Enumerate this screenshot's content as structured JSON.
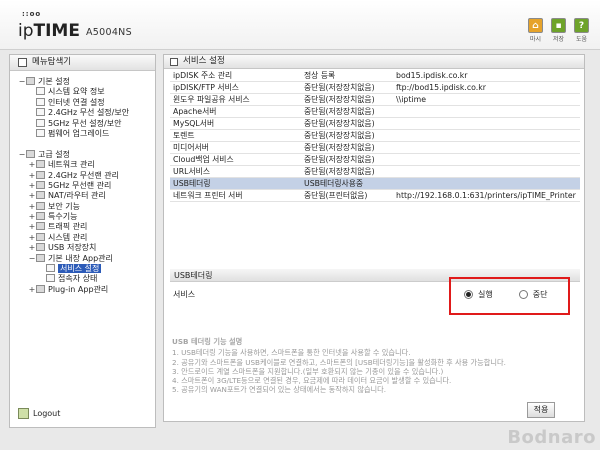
{
  "header": {
    "logo_dots": "::oo",
    "brand_prefix": "ip",
    "brand_main": "TIME",
    "model": "A5004NS",
    "icons": [
      {
        "name": "home-icon",
        "label": "마시",
        "color": "#e6a32a"
      },
      {
        "name": "save-icon",
        "label": "저장",
        "color": "#6ea32a"
      },
      {
        "name": "help-icon",
        "label": "도움",
        "color": "#6ea32a"
      }
    ]
  },
  "sidebar": {
    "title": "메뉴탐색기",
    "logout": "Logout",
    "items": [
      {
        "label": "기본 설정",
        "level": 0,
        "expander": "−",
        "type": "folder"
      },
      {
        "label": "시스템 요약 정보",
        "level": 1,
        "expander": "",
        "type": "page"
      },
      {
        "label": "인터넷 연결 설정",
        "level": 1,
        "expander": "",
        "type": "page"
      },
      {
        "label": "2.4GHz 무선 설정/보안",
        "level": 1,
        "expander": "",
        "type": "page"
      },
      {
        "label": "5GHz 무선 설정/보안",
        "level": 1,
        "expander": "",
        "type": "page"
      },
      {
        "label": "펌웨어 업그레이드",
        "level": 1,
        "expander": "",
        "type": "page"
      },
      {
        "label": "",
        "level": 0,
        "expander": "",
        "type": "spacer"
      },
      {
        "label": "고급 설정",
        "level": 0,
        "expander": "−",
        "type": "folder"
      },
      {
        "label": "네트워크 관리",
        "level": 1,
        "expander": "+",
        "type": "folder"
      },
      {
        "label": "2.4GHz 무선랜 관리",
        "level": 1,
        "expander": "+",
        "type": "folder"
      },
      {
        "label": "5GHz 무선랜 관리",
        "level": 1,
        "expander": "+",
        "type": "folder"
      },
      {
        "label": "NAT/라우터 관리",
        "level": 1,
        "expander": "+",
        "type": "folder"
      },
      {
        "label": "보안 기능",
        "level": 1,
        "expander": "+",
        "type": "folder"
      },
      {
        "label": "특수기능",
        "level": 1,
        "expander": "+",
        "type": "folder"
      },
      {
        "label": "트래픽 관리",
        "level": 1,
        "expander": "+",
        "type": "folder"
      },
      {
        "label": "시스템 관리",
        "level": 1,
        "expander": "+",
        "type": "folder"
      },
      {
        "label": "USB 저장장치",
        "level": 1,
        "expander": "+",
        "type": "folder"
      },
      {
        "label": "기본 내장 App관리",
        "level": 1,
        "expander": "−",
        "type": "folder"
      },
      {
        "label": "서비스 설정",
        "level": 2,
        "expander": "",
        "type": "page",
        "selected": true
      },
      {
        "label": "접속자 상태",
        "level": 2,
        "expander": "",
        "type": "page"
      },
      {
        "label": "Plug-in App관리",
        "level": 1,
        "expander": "+",
        "type": "folder"
      }
    ]
  },
  "main": {
    "title": "서비스 설정",
    "services": [
      {
        "name": "ipDISK 주소 관리",
        "status": "정상 등록",
        "detail": "bod15.ipdisk.co.kr"
      },
      {
        "name": "ipDISK/FTP 서비스",
        "status": "중단됨(저장장치없음)",
        "detail": "ftp://bod15.ipdisk.co.kr"
      },
      {
        "name": "윈도우 파일공유 서비스",
        "status": "중단됨(저장장치없음)",
        "detail": "\\\\iptime"
      },
      {
        "name": "Apache서버",
        "status": "중단됨(저장장치없음)",
        "detail": ""
      },
      {
        "name": "MySQL서버",
        "status": "중단됨(저장장치없음)",
        "detail": ""
      },
      {
        "name": "토렌트",
        "status": "중단됨(저장장치없음)",
        "detail": ""
      },
      {
        "name": "미디어서버",
        "status": "중단됨(저장장치없음)",
        "detail": ""
      },
      {
        "name": "Cloud백업 서비스",
        "status": "중단됨(저장장치없음)",
        "detail": ""
      },
      {
        "name": "URL서비스",
        "status": "중단됨(저장장치없음)",
        "detail": ""
      },
      {
        "name": "USB테더링",
        "status": "USB테더링사용중",
        "detail": "",
        "highlight": true
      },
      {
        "name": "네트워크 프린터 서버",
        "status": "중단됨(프린터없음)",
        "detail": "http://192.168.0.1:631/printers/ipTIME_Printer"
      }
    ],
    "subsection_title": "USB테더링",
    "service_label": "서비스",
    "radio_run": "실행",
    "radio_stop": "중단",
    "selected": "실행",
    "desc_title": "USB 테더링 기능 설명",
    "desc_lines": [
      "1. USB테더링 기능을 사용하면, 스마트폰을 통한 인터넷을 사용할 수 있습니다.",
      "2. 공유기와 스마트폰을 USB케이블로 연결하고, 스마트폰의 [USB테더링기능]을 활성화한 후 사용 가능합니다.",
      "3. 안드로이드 계열 스마트폰을 지원합니다.(일부 호환되지 않는 기종이 있을 수 있습니다.)",
      "4. 스마트폰이 3G/LTE등으로 연결된 경우, 요금제에 따라 데이터 요금이 발생할 수 있습니다.",
      "5. 공유기의 WAN포트가 연결되어 있는 상태에서는 동작하지 않습니다."
    ],
    "apply_label": "적용"
  },
  "watermark": "Bodnaro"
}
